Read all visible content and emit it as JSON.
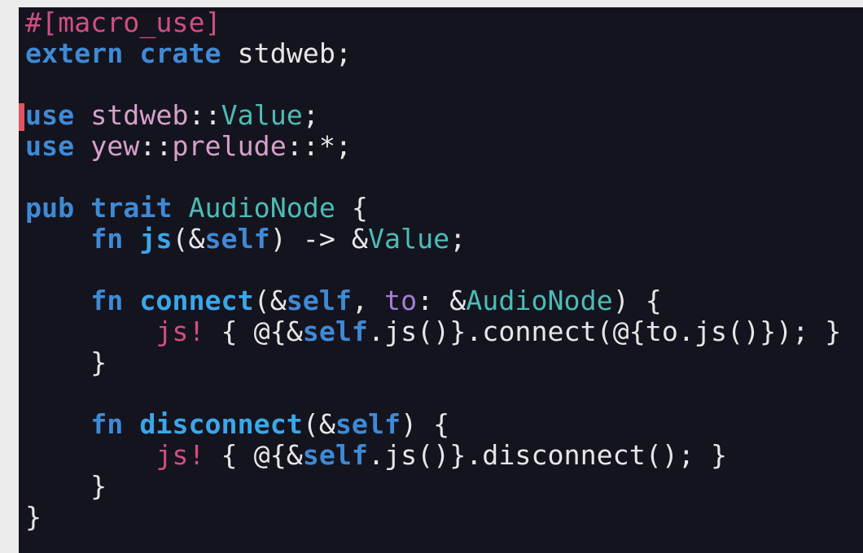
{
  "editor": {
    "language": "rust",
    "cursor_line": 4,
    "colors": {
      "background": "#14141f",
      "attribute": "#d04f7e",
      "keyword": "#3f8ad6",
      "path": "#d6a0c9",
      "type": "#4cbcb6",
      "plain": "#e6e6e6",
      "function": "#3aa7e8",
      "parameter": "#a47ed3",
      "macro": "#d04f7e",
      "cursor": "#e05561"
    },
    "lines": [
      [
        {
          "t": "attr",
          "v": "#[macro_use]"
        }
      ],
      [
        {
          "t": "keyword",
          "v": "extern"
        },
        {
          "t": "plain",
          "v": " "
        },
        {
          "t": "keyword",
          "v": "crate"
        },
        {
          "t": "plain",
          "v": " stdweb;"
        }
      ],
      [],
      [
        {
          "t": "keyword",
          "v": "use"
        },
        {
          "t": "plain",
          "v": " "
        },
        {
          "t": "path",
          "v": "stdweb"
        },
        {
          "t": "plain",
          "v": "::"
        },
        {
          "t": "type",
          "v": "Value"
        },
        {
          "t": "plain",
          "v": ";"
        }
      ],
      [
        {
          "t": "keyword",
          "v": "use"
        },
        {
          "t": "plain",
          "v": " "
        },
        {
          "t": "path",
          "v": "yew"
        },
        {
          "t": "plain",
          "v": "::"
        },
        {
          "t": "path",
          "v": "prelude"
        },
        {
          "t": "plain",
          "v": "::*;"
        }
      ],
      [],
      [
        {
          "t": "keyword",
          "v": "pub"
        },
        {
          "t": "plain",
          "v": " "
        },
        {
          "t": "keyword",
          "v": "trait"
        },
        {
          "t": "plain",
          "v": " "
        },
        {
          "t": "type",
          "v": "AudioNode"
        },
        {
          "t": "plain",
          "v": " {"
        }
      ],
      [
        {
          "t": "plain",
          "v": "    "
        },
        {
          "t": "keyword",
          "v": "fn"
        },
        {
          "t": "plain",
          "v": " "
        },
        {
          "t": "fn",
          "v": "js"
        },
        {
          "t": "plain",
          "v": "(&"
        },
        {
          "t": "self",
          "v": "self"
        },
        {
          "t": "plain",
          "v": ") -> &"
        },
        {
          "t": "type",
          "v": "Value"
        },
        {
          "t": "plain",
          "v": ";"
        }
      ],
      [],
      [
        {
          "t": "plain",
          "v": "    "
        },
        {
          "t": "keyword",
          "v": "fn"
        },
        {
          "t": "plain",
          "v": " "
        },
        {
          "t": "fn",
          "v": "connect"
        },
        {
          "t": "plain",
          "v": "(&"
        },
        {
          "t": "self",
          "v": "self"
        },
        {
          "t": "plain",
          "v": ", "
        },
        {
          "t": "param",
          "v": "to"
        },
        {
          "t": "plain",
          "v": ": &"
        },
        {
          "t": "type",
          "v": "AudioNode"
        },
        {
          "t": "plain",
          "v": ") {"
        }
      ],
      [
        {
          "t": "plain",
          "v": "        "
        },
        {
          "t": "macro",
          "v": "js!"
        },
        {
          "t": "plain",
          "v": " { @{&"
        },
        {
          "t": "self",
          "v": "self"
        },
        {
          "t": "plain",
          "v": ".js()}.connect(@{to.js()}); }"
        }
      ],
      [
        {
          "t": "plain",
          "v": "    }"
        }
      ],
      [],
      [
        {
          "t": "plain",
          "v": "    "
        },
        {
          "t": "keyword",
          "v": "fn"
        },
        {
          "t": "plain",
          "v": " "
        },
        {
          "t": "fn",
          "v": "disconnect"
        },
        {
          "t": "plain",
          "v": "(&"
        },
        {
          "t": "self",
          "v": "self"
        },
        {
          "t": "plain",
          "v": ") {"
        }
      ],
      [
        {
          "t": "plain",
          "v": "        "
        },
        {
          "t": "macro",
          "v": "js!"
        },
        {
          "t": "plain",
          "v": " { @{&"
        },
        {
          "t": "self",
          "v": "self"
        },
        {
          "t": "plain",
          "v": ".js()}.disconnect(); }"
        }
      ],
      [
        {
          "t": "plain",
          "v": "    }"
        }
      ],
      [
        {
          "t": "plain",
          "v": "}"
        }
      ]
    ]
  }
}
